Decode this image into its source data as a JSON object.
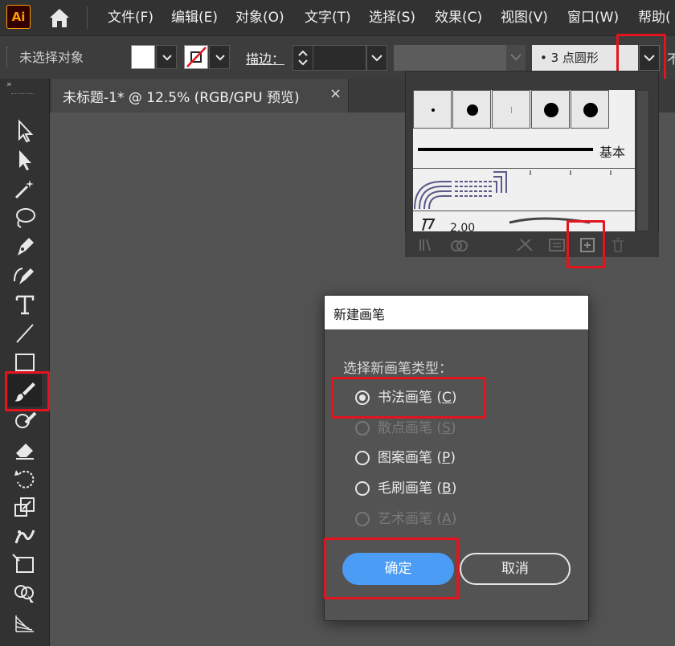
{
  "app": {
    "logo": "Ai"
  },
  "menu": [
    "文件(F)",
    "编辑(E)",
    "对象(O)",
    "文字(T)",
    "选择(S)",
    "效果(C)",
    "视图(V)",
    "窗口(W)",
    "帮助("
  ],
  "control_bar": {
    "selection_status": "未选择对象",
    "stroke_label": "描边：",
    "brush_definition": "•  3  点圆形",
    "truncated_text": "不"
  },
  "document_tab": {
    "title": "未标题-1* @ 12.5% (RGB/GPU 预览)",
    "close": "×"
  },
  "brush_library": {
    "basic_label": "基本",
    "row4_label": "2.00"
  },
  "dialog": {
    "title": "新建画笔",
    "prompt": "选择新画笔类型：",
    "options": [
      {
        "label": "书法画笔",
        "key": "C",
        "selected": true,
        "enabled": true
      },
      {
        "label": "散点画笔",
        "key": "S",
        "selected": false,
        "enabled": false
      },
      {
        "label": "图案画笔",
        "key": "P",
        "selected": false,
        "enabled": true
      },
      {
        "label": "毛刷画笔",
        "key": "B",
        "selected": false,
        "enabled": true
      },
      {
        "label": "艺术画笔",
        "key": "A",
        "selected": false,
        "enabled": false
      }
    ],
    "ok": "确定",
    "cancel": "取消"
  },
  "colors": {
    "accent": "#4a9cf5",
    "highlight": "#e3141e",
    "logo": "#ff9a00"
  }
}
